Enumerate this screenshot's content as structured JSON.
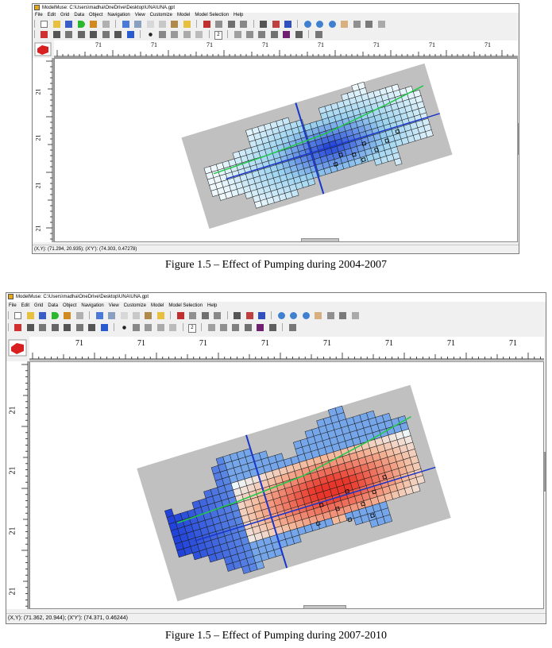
{
  "screens": [
    {
      "window_title": "ModelMuse: C:\\Users\\madha\\OneDrive\\Desktop\\UNA\\UNA.gpt",
      "menu": [
        "File",
        "Edit",
        "Grid",
        "Data",
        "Object",
        "Navigation",
        "View",
        "Customize",
        "Model",
        "Model Selection",
        "Help"
      ],
      "layer_combo": "2",
      "ruler_top_labels": [
        "71",
        "71",
        "71",
        "71",
        "71",
        "71",
        "71",
        "71"
      ],
      "ruler_left_labels": [
        "21",
        "21",
        "21",
        "21"
      ],
      "status": "(X,Y): (71.294, 20.935); (X'Y'): (74.303, 0.47278)",
      "caption": "Figure 1.5 – Effect of Pumping during 2004-2007"
    },
    {
      "window_title": "ModelMuse: C:\\Users\\madha\\OneDrive\\Desktop\\UNA\\UNA.gpt",
      "menu": [
        "File",
        "Edit",
        "Grid",
        "Data",
        "Object",
        "Navigation",
        "View",
        "Customize",
        "Model",
        "Model Selection",
        "Help"
      ],
      "layer_combo": "2",
      "ruler_top_labels": [
        "71",
        "71",
        "71",
        "71",
        "71",
        "71",
        "71",
        "71"
      ],
      "ruler_left_labels": [
        "21",
        "21",
        "21",
        "21"
      ],
      "status": "(X,Y): (71.362, 20.944); (X'Y'): (74.371, 0.46244)",
      "caption": "Figure 1.5 – Effect of Pumping during 2007-2010"
    }
  ],
  "colors": {
    "grid_background": "#c0c0c0",
    "grid_line": "#1a1a1a",
    "river_line": "#22c84a",
    "boundary_line": "#1a36c8",
    "low_head": "#1f3fd8",
    "mid_head": "#9ad2f0",
    "light_head": "#eef8fc",
    "high_head": "#e8362a"
  },
  "icons": [
    "new-file-icon",
    "open-folder-icon",
    "save-icon",
    "run-icon",
    "export-icon",
    "grid-icon",
    "zoom-in-icon",
    "zoom-out-icon",
    "pan-icon",
    "select-icon",
    "point-icon",
    "line-icon",
    "polygon-icon",
    "3d-view-icon"
  ]
}
